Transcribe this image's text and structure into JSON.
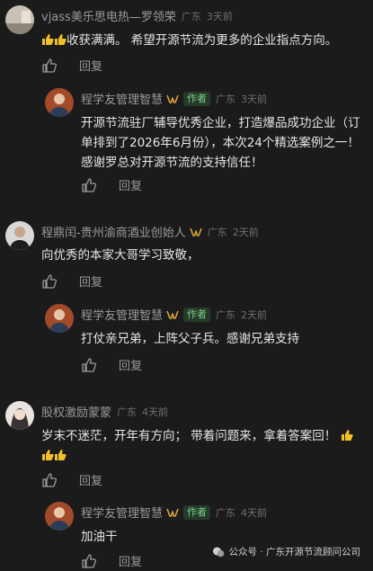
{
  "comments": [
    {
      "name": "vjass美乐思电热—罗领荣",
      "location": "广东",
      "time": "3天前",
      "text": "收获满满。 希望开源节流为更多的企业指点方向。",
      "reply_label": "回复",
      "reply": {
        "name": "程学友管理智慧",
        "author_badge": "作者",
        "location": "广东",
        "time": "3天前",
        "text": "开源节流驻厂辅导优秀企业，打造爆品成功企业（订单排到了2026年6月份），本次24个精选案例之一！感谢罗总对开源节流的支持信任！",
        "reply_label": "回复"
      }
    },
    {
      "name": "程鼎闰-贵州渝商酒业创始人",
      "location": "广东",
      "time": "2天前",
      "text": "向优秀的本家大哥学习致敬，",
      "reply_label": "回复",
      "reply": {
        "name": "程学友管理智慧",
        "author_badge": "作者",
        "location": "广东",
        "time": "2天前",
        "text": "打仗亲兄弟，上阵父子兵。感谢兄弟支持",
        "reply_label": "回复"
      }
    },
    {
      "name": "股权激励蒙蒙",
      "location": "广东",
      "time": "4天前",
      "text": "岁末不迷茫，开年有方向； 带着问题来，拿着答案回！",
      "reply_label": "回复",
      "reply": {
        "name": "程学友管理智慧",
        "author_badge": "作者",
        "location": "广东",
        "time": "4天前",
        "text": "加油干",
        "reply_label": "回复"
      }
    }
  ],
  "watermark": "公众号 · 广东开源节流顾问公司",
  "colors": {
    "background": "#1b1b1b",
    "author_badge": "#7bd38a",
    "vip_badge": "#d9a43b"
  }
}
